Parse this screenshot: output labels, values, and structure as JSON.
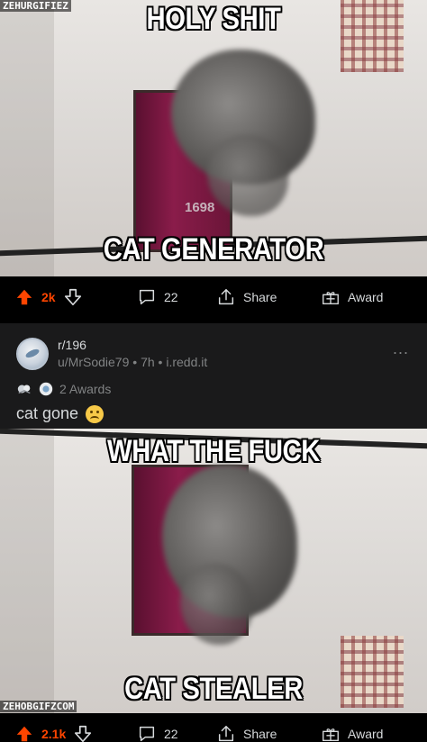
{
  "post1": {
    "caption_top": "HOLY SHIT",
    "caption_bottom": "CAT GENERATOR",
    "watermark": "ZEHURGIFIEZ",
    "image_text": "1698",
    "actions": {
      "score": "2k",
      "comments": "22",
      "share": "Share",
      "award": "Award"
    }
  },
  "post2": {
    "subreddit": "r/196",
    "user": "u/MrSodie79",
    "time": "7h",
    "domain": "i.redd.it",
    "awards": "2 Awards",
    "title": "cat gone",
    "more": "...",
    "caption_top": "WHAT THE FUCK",
    "caption_bottom": "CAT STEALER",
    "watermark": "ZEHOBGIFZCOM",
    "actions": {
      "score": "2.1k",
      "comments": "22",
      "share": "Share",
      "award": "Award"
    }
  },
  "colors": {
    "upvote": "#ff4500",
    "card_bg": "#1a1a1b",
    "text": "#d7dadc",
    "muted": "#818384"
  }
}
